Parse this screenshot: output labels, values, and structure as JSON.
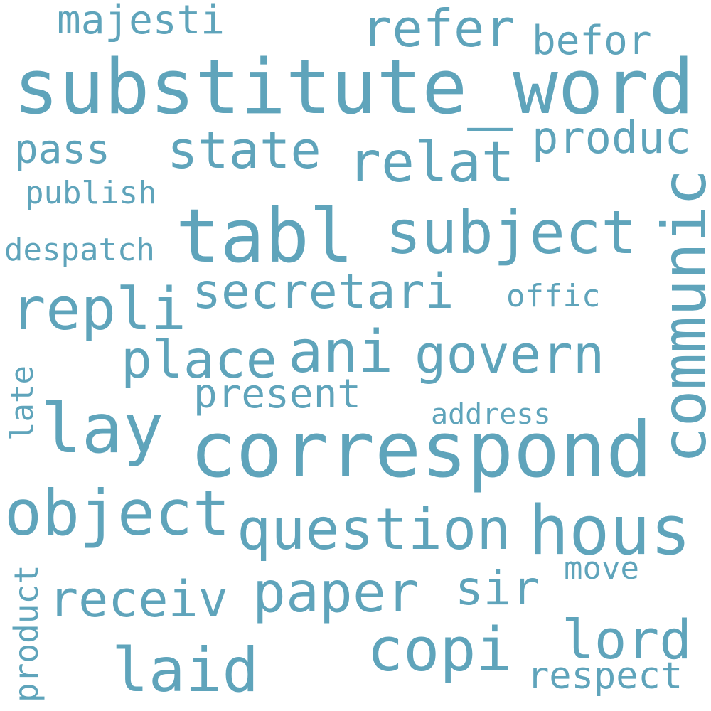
{
  "cloud": {
    "color": "#5fa4bb",
    "words": [
      "substitute_word",
      "correspond",
      "tabl",
      "subject",
      "communic",
      "object",
      "question",
      "hous",
      "lay",
      "refer",
      "state",
      "relat",
      "repli",
      "secretari",
      "ani",
      "govern",
      "place",
      "paper",
      "copi",
      "laid",
      "receiv",
      "lord",
      "sir",
      "produc",
      "present",
      "pass",
      "befor",
      "majesti",
      "despatch",
      "publish",
      "offic",
      "address",
      "respect",
      "move",
      "late",
      "product"
    ]
  }
}
